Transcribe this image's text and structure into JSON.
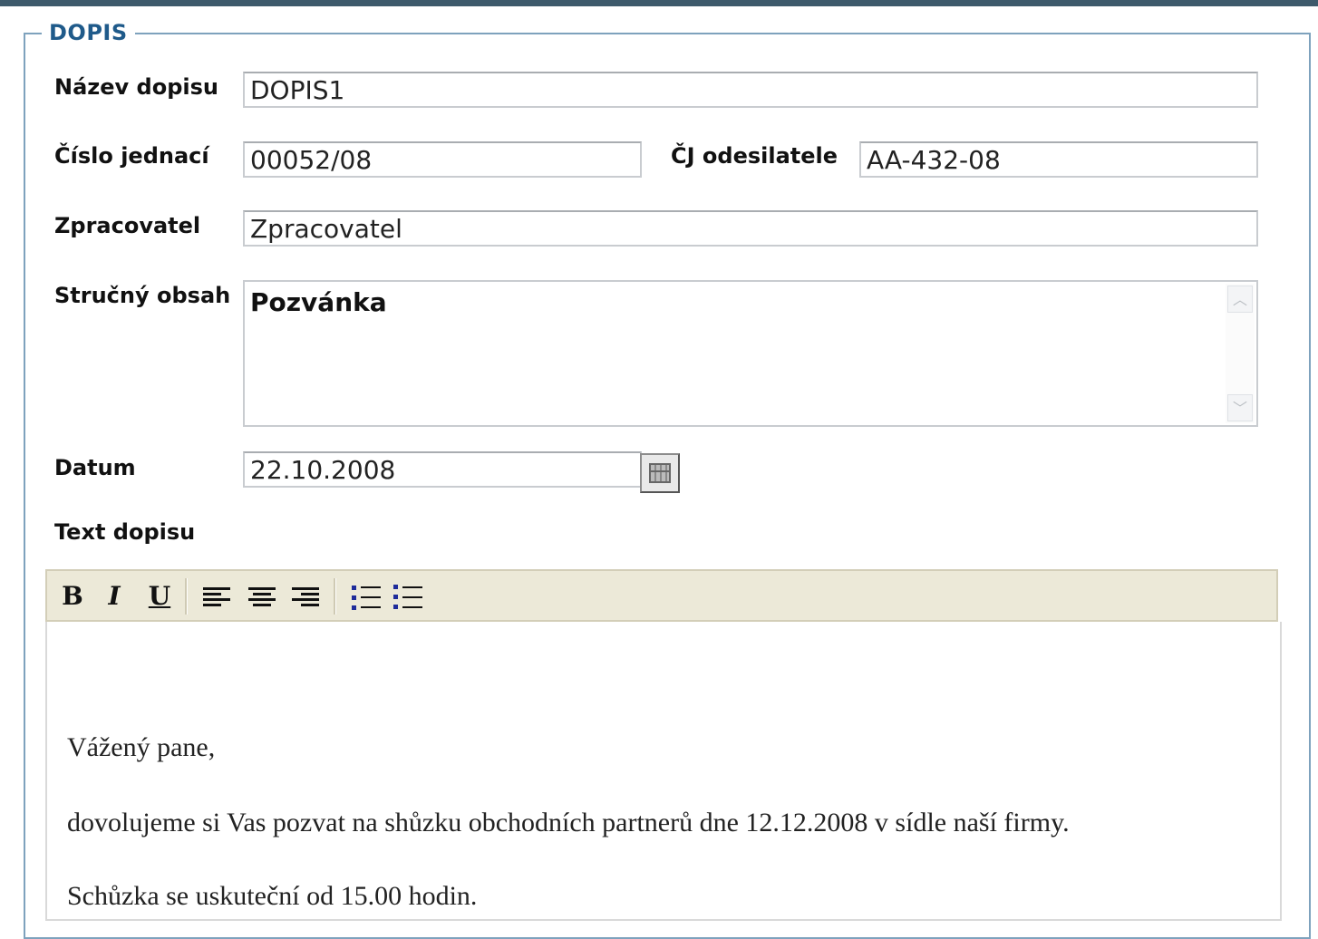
{
  "section": {
    "legend": "DOPIS"
  },
  "fields": {
    "nazev": {
      "label": "Název dopisu",
      "value": "DOPIS1"
    },
    "cislo": {
      "label": "Číslo jednací",
      "value": "00052/08"
    },
    "cj_odesilatele": {
      "label": "ČJ odesilatele",
      "value": "AA-432-08"
    },
    "zpracovatel": {
      "label": "Zpracovatel",
      "value": "Zpracovatel"
    },
    "obsah": {
      "label": "Stručný obsah",
      "value": "Pozvánka"
    },
    "datum": {
      "label": "Datum",
      "value": "22.10.2008"
    },
    "text": {
      "label": "Text dopisu"
    }
  },
  "toolbar": {
    "bold": "B",
    "italic": "I",
    "underline": "U"
  },
  "icons": [
    "calendar-icon",
    "align-left-icon",
    "align-center-icon",
    "align-right-icon",
    "ordered-list-icon",
    "unordered-list-icon",
    "scroll-up-icon",
    "scroll-down-icon"
  ],
  "editor": {
    "greeting": "Vážený pane,",
    "paragraph1": "dovolujeme si Vas pozvat na shůzku obchodních partnerů dne 12.12.2008 v sídle naší firmy.",
    "paragraph2": "Schůzka se uskuteční od 15.00 hodin."
  },
  "colors": {
    "legend": "#1f5a8a",
    "border": "#7ea2bd",
    "toolbar": "#ece9d8",
    "topline": "#3e5a6b"
  }
}
